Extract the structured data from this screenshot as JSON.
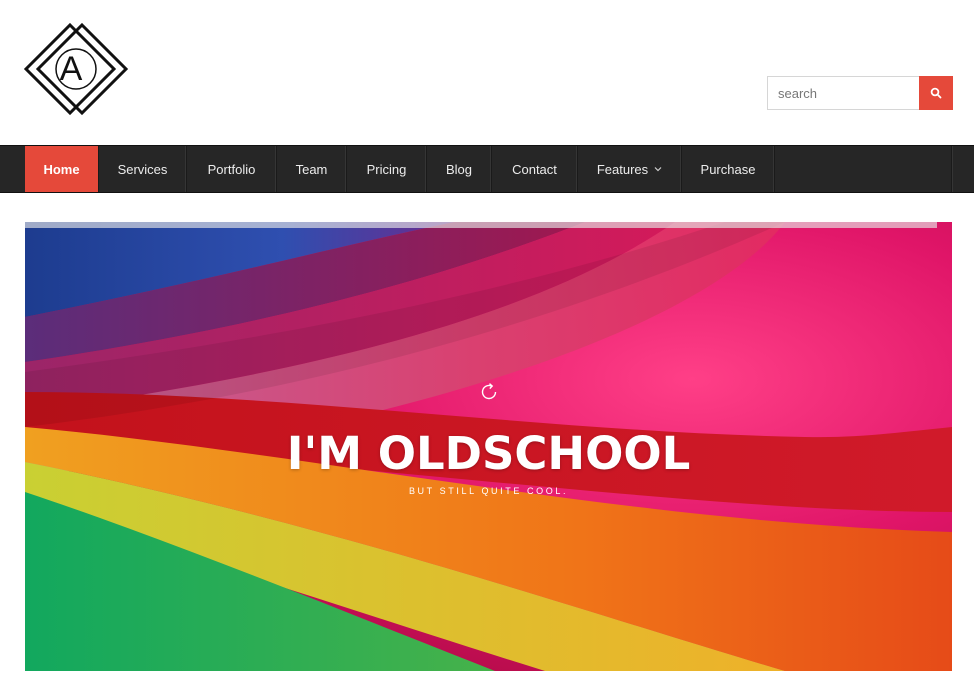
{
  "header": {
    "logo_letter": "A",
    "search": {
      "placeholder": "search",
      "value": "",
      "button_icon": "search-icon"
    }
  },
  "nav": {
    "items": [
      {
        "label": "Home",
        "active": true
      },
      {
        "label": "Services"
      },
      {
        "label": "Portfolio"
      },
      {
        "label": "Team"
      },
      {
        "label": "Pricing"
      },
      {
        "label": "Blog"
      },
      {
        "label": "Contact"
      },
      {
        "label": "Features",
        "dropdown_icon": "chevron-down-icon"
      },
      {
        "label": "Purchase"
      }
    ]
  },
  "hero": {
    "icon": "reload-icon",
    "title": "I'M OLDSCHOOL",
    "subtitle": "BUT STILL QUITE COOL."
  },
  "colors": {
    "accent": "#e5493a",
    "nav_background": "#262626",
    "header_background": "#ffffff"
  }
}
